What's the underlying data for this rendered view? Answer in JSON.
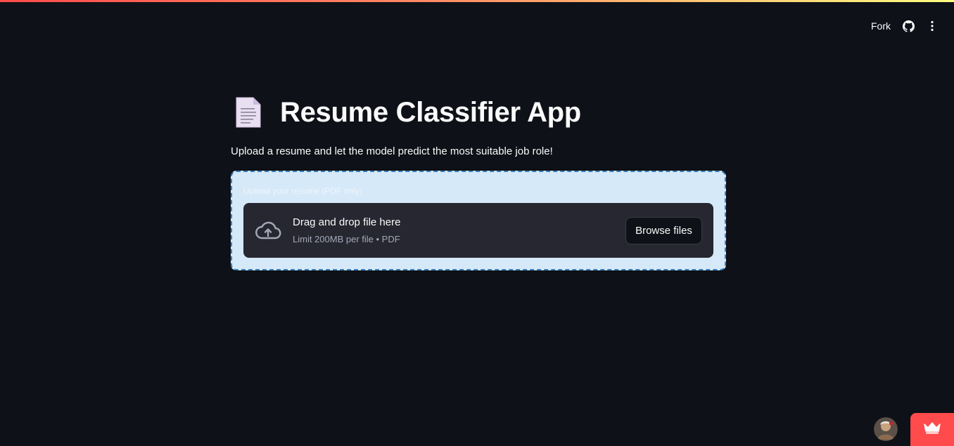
{
  "toolbar": {
    "fork_label": "Fork",
    "github_icon": "github-icon",
    "menu_icon": "more-vertical-icon"
  },
  "header": {
    "icon": "page-facing-up-icon",
    "title": "Resume Classifier App",
    "subtitle": "Upload a resume and let the model predict the most suitable job role!"
  },
  "uploader": {
    "label": "Upload your resume (PDF only)",
    "icon": "cloud-upload-icon",
    "dropzone_title": "Drag and drop file here",
    "dropzone_limit": "Limit 200MB per file • PDF",
    "browse_label": "Browse files"
  },
  "footer": {
    "avatar_icon": "user-avatar",
    "badge_icon": "crown-icon"
  },
  "colors": {
    "background": "#0e1117",
    "accent": "#ff4b4b",
    "uploader_bg": "#d6e9f8",
    "dropzone_bg": "#262730"
  }
}
